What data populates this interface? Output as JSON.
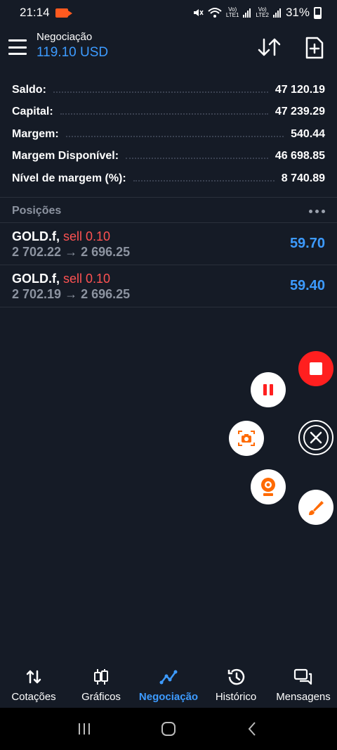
{
  "status_bar": {
    "time": "21:14",
    "battery": "31%",
    "sim1": "Vo)) LTE1",
    "sim2": "Vo)) LTE2"
  },
  "header": {
    "title": "Negociação",
    "balance": "119.10 USD"
  },
  "summary": [
    {
      "label": "Saldo:",
      "value": "47 120.19"
    },
    {
      "label": "Capital:",
      "value": "47 239.29"
    },
    {
      "label": "Margem:",
      "value": "540.44"
    },
    {
      "label": "Margem Disponível:",
      "value": "46 698.85"
    },
    {
      "label": "Nível de margem (%):",
      "value": "8 740.89"
    }
  ],
  "positions": {
    "title": "Posições",
    "items": [
      {
        "symbol": "GOLD.f,",
        "side": "sell 0.10",
        "prices": "2 702.22 → 2 696.25",
        "profit": "59.70"
      },
      {
        "symbol": "GOLD.f,",
        "side": "sell 0.10",
        "prices": "2 702.19 → 2 696.25",
        "profit": "59.40"
      }
    ]
  },
  "nav": [
    {
      "label": "Cotações",
      "icon": "arrows-updown-icon"
    },
    {
      "label": "Gráficos",
      "icon": "candlestick-icon"
    },
    {
      "label": "Negociação",
      "icon": "trade-line-icon",
      "active": true
    },
    {
      "label": "Histórico",
      "icon": "history-clock-icon"
    },
    {
      "label": "Mensagens",
      "icon": "messages-icon"
    }
  ],
  "colors": {
    "accent": "#3d9bff",
    "sell": "#ff5252",
    "background": "#151b26",
    "record": "#ff1f1f",
    "recorder_orange": "#ff6a00"
  }
}
